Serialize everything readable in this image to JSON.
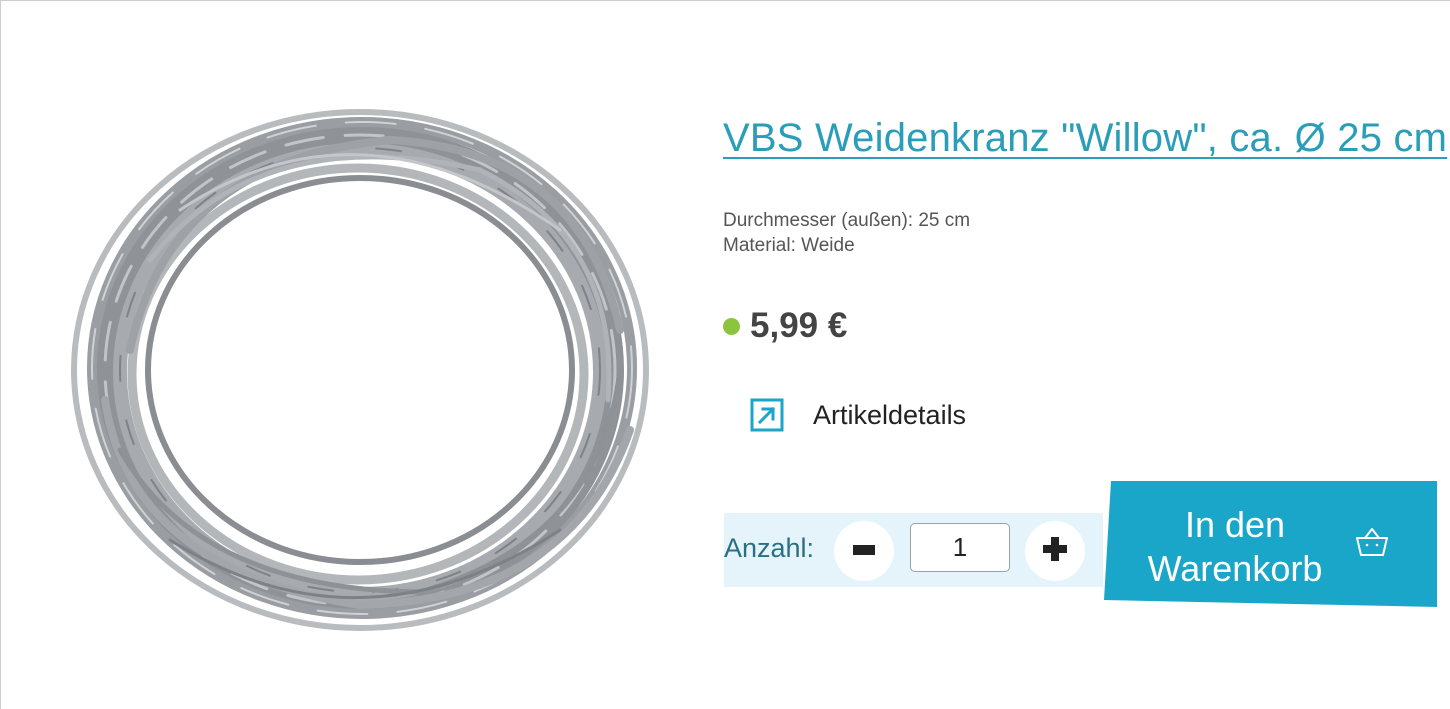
{
  "product": {
    "title": "VBS Weidenkranz \"Willow\", ca. Ø 25 cm",
    "attributes": [
      "Durchmesser (außen): 25 cm",
      "Material: Weide"
    ],
    "price": "5,99 €",
    "availability_color": "#8bc53f",
    "details_link": "Artikeldetails",
    "details_icon": "external-arrow-icon",
    "image": "willow-wreath"
  },
  "cart": {
    "quantity_label": "Anzahl:",
    "quantity_value": "1",
    "minus_icon": "minus-icon",
    "plus_icon": "plus-icon",
    "button_line1": "In den",
    "button_line2": "Warenkorb",
    "button_icon": "basket-icon",
    "accent_color": "#1aa6c8"
  }
}
